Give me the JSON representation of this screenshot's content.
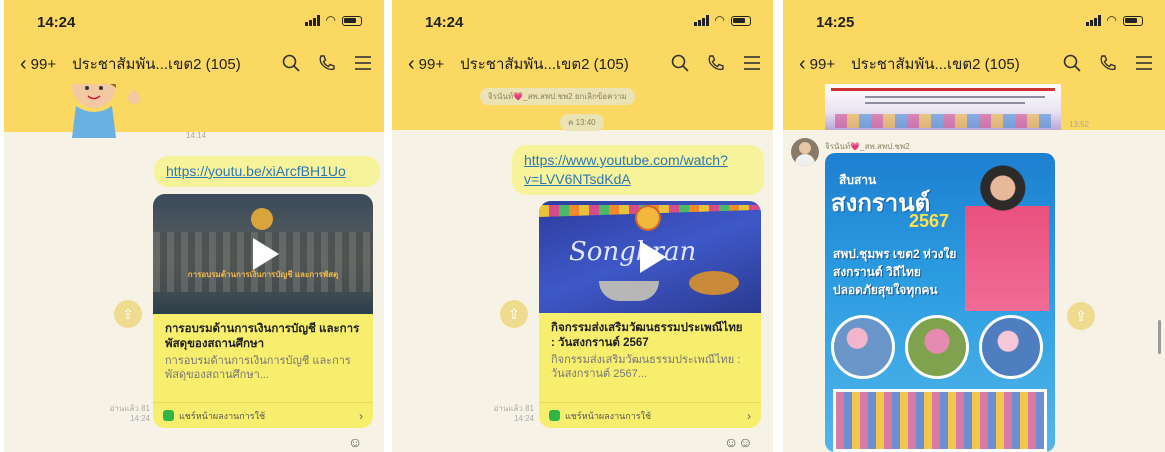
{
  "status": {
    "time_1": "14:24",
    "time_2": "14:24",
    "time_3": "14:25"
  },
  "header": {
    "back_count": "99+",
    "chat_title": "ประชาสัมพัน...เขต2 (105)"
  },
  "panel1": {
    "link": "https://youtu.be/xiArcfBH1Uo",
    "thumb_text": "การอบรมด้านการเงินการบัญชี และการพัสดุ",
    "card_title": "การอบรมด้านการเงินการบัญชี และการพัสดุของสถานศึกษา",
    "card_desc": "การอบรมด้านการเงินการบัญชี และการพัสดุของสถานศึกษา...",
    "card_footer": "แชร์หน้าผลงานการใช้",
    "read_status": "อ่านแล้ว 81",
    "time": "14:24",
    "sticker_time": "14:14"
  },
  "panel2": {
    "system_msg": "จิรนันท์💗_สพ.สพป.ชพ2 ยกเลิกข้อความ",
    "time_pill": "ค 13:40",
    "link": "https://www.youtube.com/watch?v=LVV6NTsdKdA",
    "thumb_text": "Songkran",
    "card_title": "กิจกรรมส่งเสริมวัฒนธรรมประเพณีไทย : วันสงกรานต์ 2567",
    "card_desc": "กิจกรรมส่งเสริมวัฒนธรรมประเพณีไทย : วันสงกรานต์ 2567...",
    "card_footer": "แชร์หน้าผลงานการใช้",
    "read_status": "อ่านแล้ว 81",
    "time": "14:24"
  },
  "panel3": {
    "sender": "จิรนันท์💗_สพ.สพป.ชพ2",
    "poster_title_1": "สืบสาน",
    "poster_title_2": "สงกรานต์",
    "poster_year": "2567",
    "poster_line_1": "สพป.ชุมพร เขต2 ห่วงใย",
    "poster_line_2": "สงกรานต์ วิถีไทย",
    "poster_line_3": "ปลอดภัยสุขใจทุกคน",
    "prev_time": "13:52"
  },
  "colors": {
    "header": "#fbd862",
    "bubble": "#f7f39a",
    "card": "#f7ee6e",
    "link": "#2e77b6"
  }
}
